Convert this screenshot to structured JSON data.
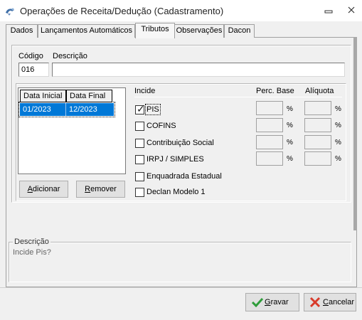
{
  "window": {
    "title": "Operações de Receita/Dedução (Cadastramento)",
    "minimize_glyph": "▭",
    "close_glyph": "✕",
    "app_icon": "app-logo-icon"
  },
  "tabs": [
    {
      "label": "Dados",
      "active": false
    },
    {
      "label": "Lançamentos Automáticos",
      "active": false
    },
    {
      "label": "Tributos",
      "active": true
    },
    {
      "label": "Observações",
      "active": false
    },
    {
      "label": "Dacon",
      "active": false
    }
  ],
  "header": {
    "codigo_label": "Código",
    "codigo_value": "016",
    "descricao_label": "Descrição",
    "descricao_value": ""
  },
  "grid": {
    "columns": [
      "Data Inicial",
      "Data Final"
    ],
    "rows": [
      [
        "01/2023",
        "12/2023"
      ]
    ]
  },
  "buttons": {
    "adicionar_prefix": "",
    "adicionar_hotkey": "A",
    "adicionar_rest": "dicionar",
    "remover_prefix": "",
    "remover_hotkey": "R",
    "remover_rest": "emover"
  },
  "incide": {
    "heading": "Incide",
    "perc_base_heading": "Perc. Base",
    "aliquota_heading": "Alíquota",
    "pct_symbol": "%",
    "items": [
      {
        "label": "PIS",
        "checked": true
      },
      {
        "label": "COFINS",
        "checked": false
      },
      {
        "label": "Contribuição Social",
        "checked": false
      },
      {
        "label": "IRPJ / SIMPLES",
        "checked": false
      },
      {
        "label": "Enquadrada Estadual",
        "checked": false
      },
      {
        "label": "Declan Modelo 1",
        "checked": false
      }
    ]
  },
  "descricao_box": {
    "label": "Descrição",
    "text": "Incide Pis?"
  },
  "footer": {
    "gravar_hotkey": "G",
    "gravar_rest": "ravar",
    "cancelar_hotkey": "C",
    "cancelar_rest": "ancelar",
    "gravar_icon": "checkmark-icon",
    "cancelar_icon": "x-icon",
    "gravar_color": "#2e9d3a",
    "cancelar_color": "#d83b2b"
  }
}
